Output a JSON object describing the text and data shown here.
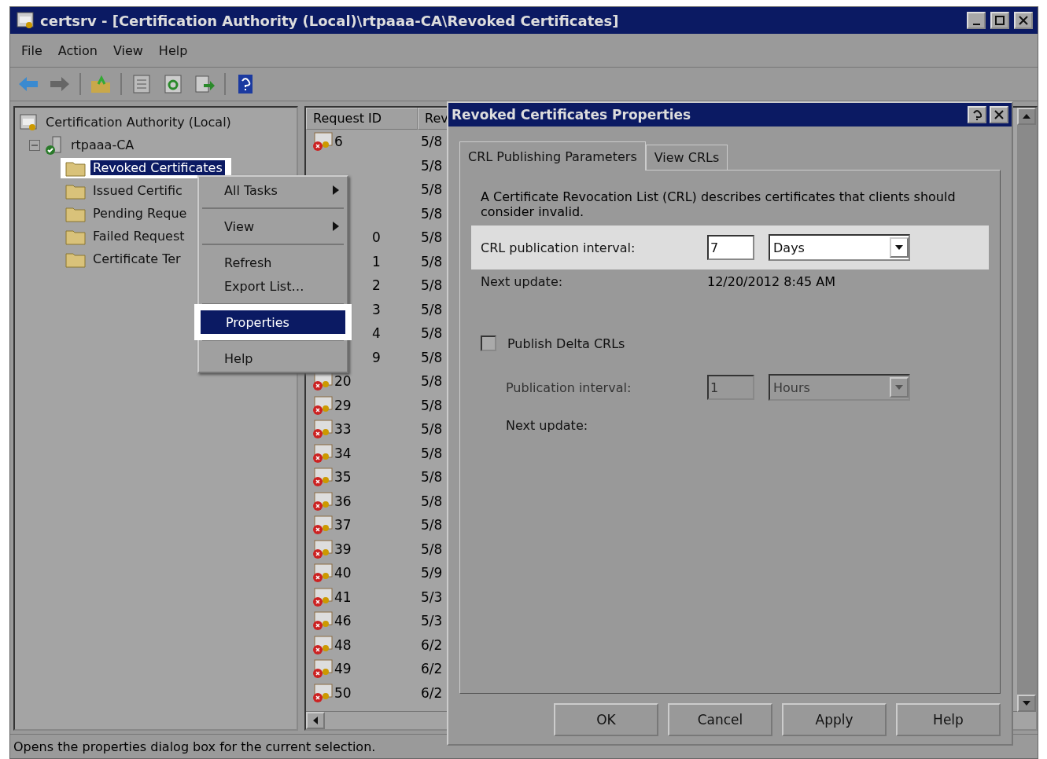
{
  "window": {
    "title": "certsrv - [Certification Authority (Local)\\rtpaaa-CA\\Revoked Certificates]"
  },
  "menu_bar": [
    "File",
    "Action",
    "View",
    "Help"
  ],
  "tree": [
    {
      "label": "Certification Authority (Local)",
      "kind": "authority",
      "selected": false,
      "children": [
        {
          "label": "rtpaaa-CA",
          "kind": "server",
          "selected": false,
          "expanded": true,
          "children": [
            {
              "label": "Revoked Certificates",
              "kind": "folder",
              "selected": true
            },
            {
              "label": "Issued Certific",
              "kind": "folder",
              "selected": false
            },
            {
              "label": "Pending Reque",
              "kind": "folder",
              "selected": false
            },
            {
              "label": "Failed Request",
              "kind": "folder",
              "selected": false
            },
            {
              "label": "Certificate Ter",
              "kind": "folder",
              "selected": false
            }
          ]
        }
      ]
    }
  ],
  "list": {
    "columns": [
      "Request ID",
      "Rev"
    ],
    "rows": [
      {
        "request_id": "6",
        "column_2": "5/8",
        "covered": false
      },
      {
        "column_2": "5/8"
      },
      {
        "column_2": "5/8"
      },
      {
        "column_2": "5/8"
      },
      {
        "request_id": "0",
        "column_2": "5/8",
        "covered": true
      },
      {
        "request_id": "1",
        "column_2": "5/8",
        "covered": true
      },
      {
        "request_id": "2",
        "column_2": "5/8",
        "covered": true
      },
      {
        "request_id": "3",
        "column_2": "5/8",
        "covered": true
      },
      {
        "request_id": "4",
        "column_2": "5/8",
        "covered": true
      },
      {
        "request_id": "9",
        "column_2": "5/8",
        "covered": true
      },
      {
        "request_id": "20",
        "column_2": "5/8",
        "covered": false
      },
      {
        "request_id": "29",
        "column_2": "5/8",
        "covered": false
      },
      {
        "request_id": "33",
        "column_2": "5/8",
        "covered": false
      },
      {
        "request_id": "34",
        "column_2": "5/8",
        "covered": false
      },
      {
        "request_id": "35",
        "column_2": "5/8",
        "covered": false
      },
      {
        "request_id": "36",
        "column_2": "5/8",
        "covered": false
      },
      {
        "request_id": "37",
        "column_2": "5/8",
        "covered": false
      },
      {
        "request_id": "39",
        "column_2": "5/8",
        "covered": false
      },
      {
        "request_id": "40",
        "column_2": "5/9",
        "covered": false
      },
      {
        "request_id": "41",
        "column_2": "5/3",
        "covered": false
      },
      {
        "request_id": "46",
        "column_2": "5/3",
        "covered": false
      },
      {
        "request_id": "48",
        "column_2": "6/2",
        "covered": false
      },
      {
        "request_id": "49",
        "column_2": "6/2",
        "covered": false
      },
      {
        "request_id": "50",
        "column_2": "6/2",
        "covered": false
      }
    ]
  },
  "context_menu": [
    {
      "kind": "item",
      "label": "All Tasks",
      "submenu": true,
      "selected": false
    },
    {
      "kind": "separator"
    },
    {
      "kind": "item",
      "label": "View",
      "submenu": true,
      "selected": false
    },
    {
      "kind": "separator"
    },
    {
      "kind": "item",
      "label": "Refresh",
      "submenu": false,
      "selected": false
    },
    {
      "kind": "item",
      "label": "Export List…",
      "submenu": false,
      "selected": false
    },
    {
      "kind": "separator"
    },
    {
      "kind": "item",
      "label": "Properties",
      "submenu": false,
      "selected": true
    },
    {
      "kind": "separator"
    },
    {
      "kind": "item",
      "label": "Help",
      "submenu": false,
      "selected": false
    }
  ],
  "dialog": {
    "title": "Revoked Certificates Properties",
    "tabs": [
      {
        "label": "CRL Publishing Parameters",
        "selected": true
      },
      {
        "label": "View CRLs",
        "selected": false
      }
    ],
    "description": "A Certificate Revocation List (CRL) describes certificates that clients should consider invalid.",
    "crl_interval": {
      "label": "CRL publication interval:",
      "value": "7",
      "unit": "Days",
      "highlighted": true
    },
    "next_update": {
      "label": "Next update:",
      "value": "12/20/2012 8:45 AM"
    },
    "delta": {
      "label": "Publish Delta CRLs",
      "checked": false
    },
    "delta_interval": {
      "label": "Publication interval:",
      "value": "1",
      "unit": "Hours",
      "disabled": true
    },
    "delta_next_update": {
      "label": "Next update:"
    },
    "buttons": [
      "OK",
      "Cancel",
      "Apply",
      "Help"
    ]
  },
  "status_bar": "Opens the properties dialog box for the current selection."
}
